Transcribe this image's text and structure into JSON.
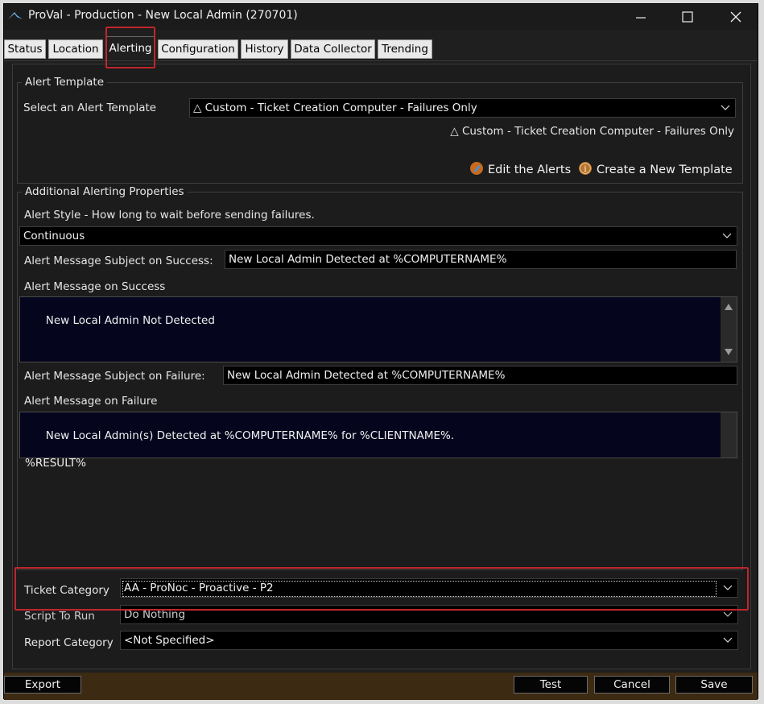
{
  "window": {
    "title": "ProVal - Production - New Local Admin (270701)",
    "app_icon": "proval-logo-icon",
    "controls": [
      "minimize-icon",
      "maximize-icon",
      "close-icon"
    ]
  },
  "tabs": [
    {
      "label": "Status",
      "active": false
    },
    {
      "label": "Location",
      "active": false
    },
    {
      "label": "Alerting",
      "active": true
    },
    {
      "label": "Configuration",
      "active": false
    },
    {
      "label": "History",
      "active": false
    },
    {
      "label": "Data Collector",
      "active": false
    },
    {
      "label": "Trending",
      "active": false
    }
  ],
  "alert_template": {
    "legend": "Alert Template",
    "select_label": "Select an Alert Template",
    "selected": "△ Custom - Ticket Creation Computer - Failures Only",
    "selected_caption": "△ Custom - Ticket Creation Computer - Failures Only",
    "edit_link": "Edit the Alerts",
    "create_link": "Create a New Template"
  },
  "additional": {
    "legend": "Additional Alerting Properties",
    "alert_style_label": "Alert Style - How long to wait before sending failures.",
    "alert_style_value": "Continuous",
    "success_subject_label": "Alert Message Subject on Success:",
    "success_subject_value": "New Local Admin Detected at %COMPUTERNAME%",
    "success_message_label": "Alert Message on Success",
    "success_message_value": "New Local Admin Not Detected",
    "failure_subject_label": "Alert Message Subject on Failure:",
    "failure_subject_value": "New Local Admin Detected at %COMPUTERNAME%",
    "failure_message_label": "Alert Message on Failure",
    "failure_message_value": "New Local Admin(s) Detected at %COMPUTERNAME% for %CLIENTNAME%.\n\n%RESULT%"
  },
  "bottom": {
    "ticket_category_label": "Ticket Category",
    "ticket_category_value": "AA - ProNoc - Proactive - P2",
    "script_label": "Script To Run",
    "script_value": "Do Nothing",
    "report_category_label": "Report Category",
    "report_category_value": "<Not Specified>"
  },
  "footer": {
    "export": "Export",
    "test": "Test",
    "cancel": "Cancel",
    "save": "Save"
  },
  "colors": {
    "highlight": "#c0262b",
    "footer_bar": "#3d2a12",
    "textarea_bg": "#05051e"
  }
}
